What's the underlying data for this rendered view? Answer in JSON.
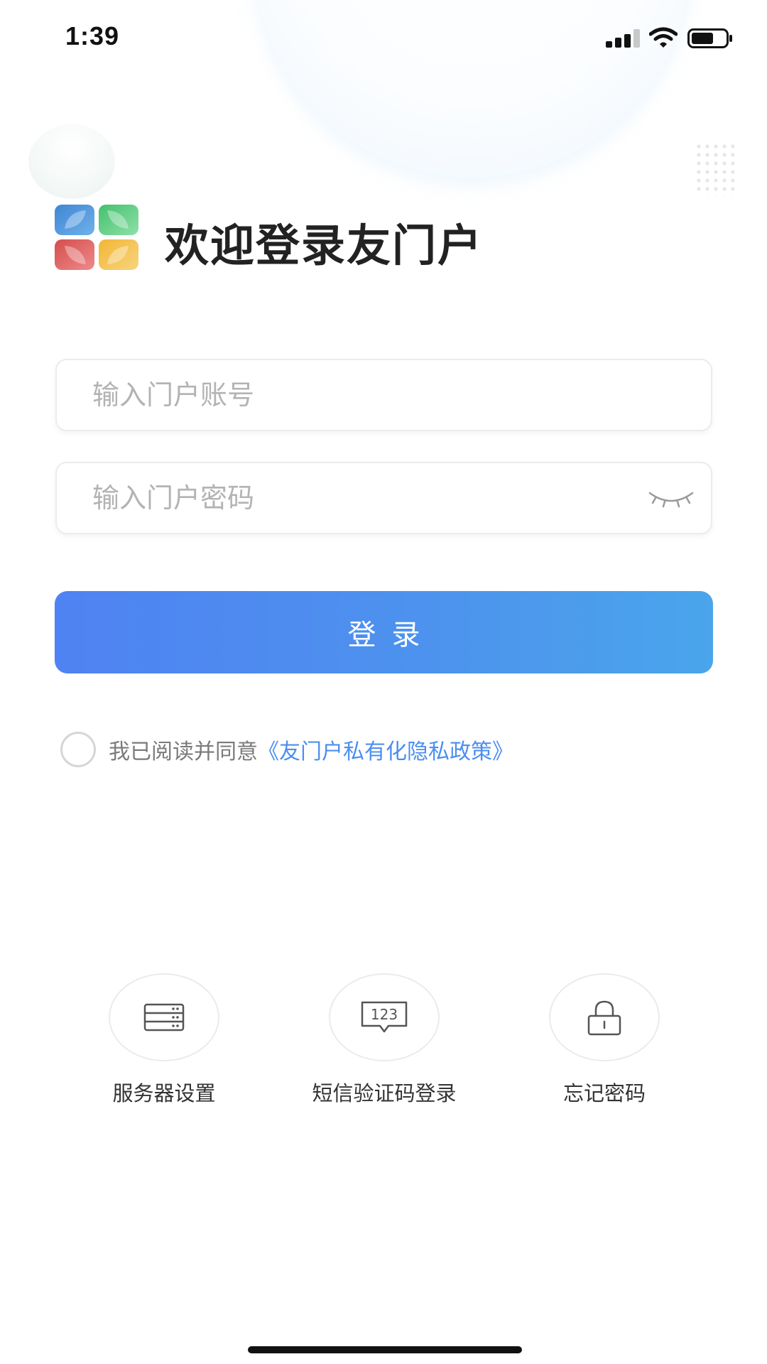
{
  "status_bar": {
    "time": "1:39"
  },
  "header": {
    "title": "欢迎登录友门户"
  },
  "form": {
    "account_placeholder": "输入门户账号",
    "account_value": "",
    "password_placeholder": "输入门户密码",
    "password_value": "",
    "login_label": "登录"
  },
  "agreement": {
    "text": "我已阅读并同意",
    "link": "《友门户私有化隐私政策》",
    "checked": false
  },
  "options": [
    {
      "label": "服务器设置",
      "icon": "server-icon"
    },
    {
      "label": "短信验证码登录",
      "icon": "sms-code-icon"
    },
    {
      "label": "忘记密码",
      "icon": "lock-icon"
    }
  ],
  "colors": {
    "accent": "#4c8ef0",
    "button_gradient_start": "#4f82f2",
    "button_gradient_end": "#4aa5eb",
    "logo_blue": "#4a90d9",
    "logo_green": "#52c77a",
    "logo_red": "#d95757",
    "logo_yellow": "#f0b94a"
  }
}
